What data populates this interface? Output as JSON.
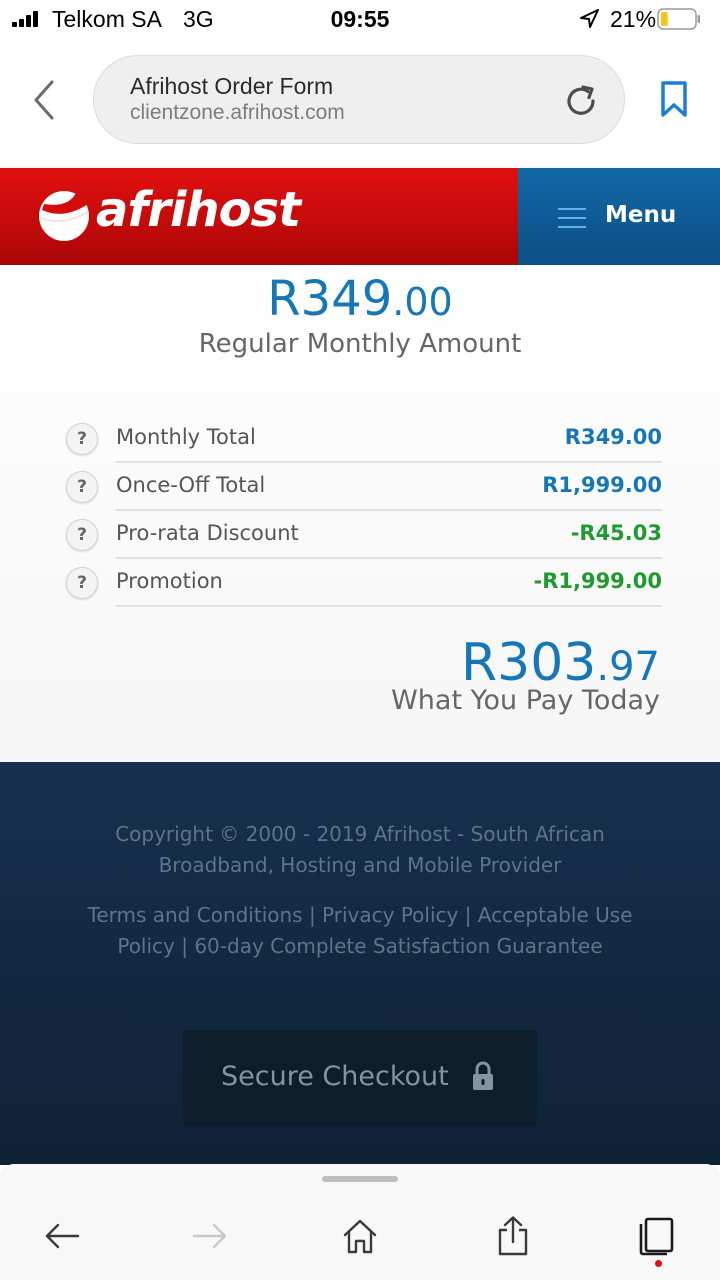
{
  "status_bar": {
    "carrier": "Telkom SA",
    "network": "3G",
    "time": "09:55",
    "battery_percent": "21%",
    "battery_level": 0.21,
    "battery_color": "#f5c518"
  },
  "browser": {
    "page_title": "Afrihost Order Form",
    "domain": "clientzone.afrihost.com",
    "accent_color": "#1a7fd6"
  },
  "header": {
    "brand": "afrihost",
    "menu_label": "Menu",
    "brand_color": "#c80b0b",
    "menu_color": "#0d5a95"
  },
  "summary": {
    "regular_amount_main": "R349",
    "regular_amount_cents": ".00",
    "regular_label": "Regular Monthly Amount",
    "rows": [
      {
        "label": "Monthly Total",
        "value": "R349.00",
        "value_color": "#1677b8"
      },
      {
        "label": "Once-Off Total",
        "value": "R1,999.00",
        "value_color": "#1677b8"
      },
      {
        "label": "Pro-rata Discount",
        "value": "-R45.03",
        "value_color": "#1e9a2e"
      },
      {
        "label": "Promotion",
        "value": "-R1,999.00",
        "value_color": "#1e9a2e"
      }
    ],
    "help_symbol": "?",
    "pay_amount_main": "R303",
    "pay_amount_cents": ".97",
    "pay_label": "What You Pay Today"
  },
  "footer": {
    "copyright": "Copyright © 2000 - 2019 Afrihost - South African Broadband, Hosting and Mobile Provider",
    "links": "Terms and Conditions | Privacy Policy | Acceptable Use Policy | 60-day Complete Satisfaction Guarantee",
    "checkout_label": "Secure Checkout"
  },
  "toolbar": {
    "icons": [
      "back-arrow-icon",
      "forward-arrow-icon",
      "home-icon",
      "share-icon",
      "tabs-icon"
    ],
    "notification_color": "#e01010"
  }
}
